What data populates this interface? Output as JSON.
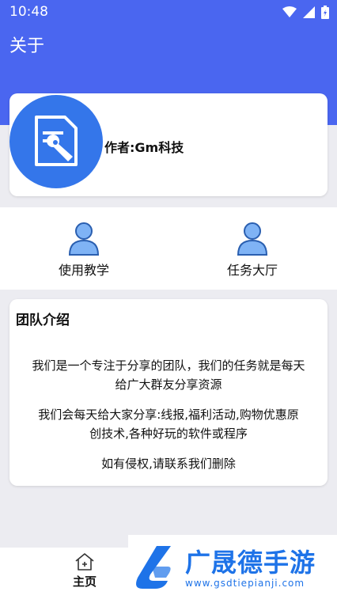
{
  "status_bar": {
    "time": "10:48"
  },
  "header": {
    "title": "关于"
  },
  "author": {
    "label": "作者:Gm科技"
  },
  "shortcuts": [
    {
      "label": "使用教学"
    },
    {
      "label": "任务大厅"
    }
  ],
  "intro": {
    "title": "团队介绍",
    "paragraphs": [
      "我们是一个专注于分享的团队，我们的任务就是每天给广大群友分享资源",
      "我们会每天给大家分享:线报,福利活动,购物优惠原创技术,各种好玩的软件或程序",
      "如有侵权,请联系我们删除"
    ]
  },
  "bottom_nav": {
    "home_label": "主页"
  },
  "watermark": {
    "name": "广晟德手游",
    "url": "www.gsdtiepianji.com"
  },
  "colors": {
    "header": "#4a66f0",
    "logo": "#3476ea",
    "watermark": "#1e73e8"
  }
}
